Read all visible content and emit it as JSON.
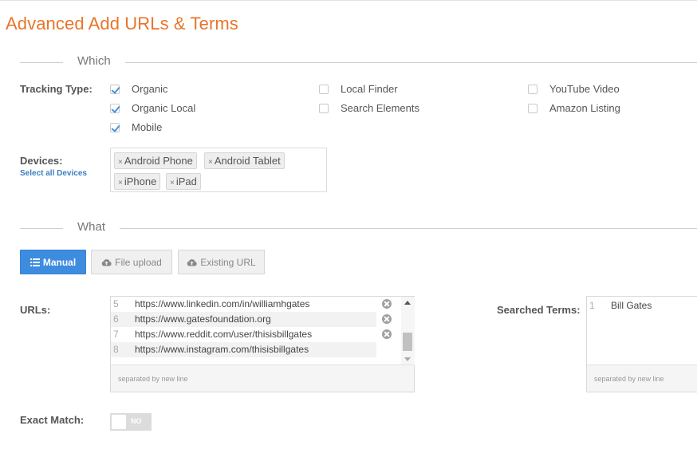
{
  "page": {
    "title": "Advanced Add URLs & Terms"
  },
  "which": {
    "heading": "Which",
    "tracking_label": "Tracking Type:",
    "tracking_types": [
      {
        "label": "Organic",
        "checked": true
      },
      {
        "label": "Organic Local",
        "checked": true
      },
      {
        "label": "Mobile",
        "checked": true
      },
      {
        "label": "Local Finder",
        "checked": false
      },
      {
        "label": "Search Elements",
        "checked": false
      },
      {
        "label": "YouTube Video",
        "checked": false
      },
      {
        "label": "Amazon Listing",
        "checked": false
      }
    ],
    "devices_label": "Devices:",
    "select_all_devices": "Select all Devices",
    "devices": [
      "Android Phone",
      "Android Tablet",
      "iPhone",
      "iPad"
    ],
    "remove_glyph": "×"
  },
  "what": {
    "heading": "What",
    "tabs": [
      {
        "label": "Manual",
        "icon": "list-icon",
        "active": true
      },
      {
        "label": "File upload",
        "icon": "cloud-upload-icon",
        "active": false
      },
      {
        "label": "Existing URL",
        "icon": "cloud-upload-icon",
        "active": false
      }
    ],
    "urls_label": "URLs:",
    "urls": [
      {
        "line": "5",
        "url": "https://www.linkedin.com/in/williamhgates"
      },
      {
        "line": "6",
        "url": "https://www.gatesfoundation.org"
      },
      {
        "line": "7",
        "url": "https://www.reddit.com/user/thisisbillgates"
      },
      {
        "line": "8",
        "url": "https://www.instagram.com/thisisbillgates"
      }
    ],
    "urls_hint": "separated by new line",
    "terms_label": "Searched Terms:",
    "terms": [
      {
        "line": "1",
        "term": "Bill Gates"
      }
    ],
    "terms_hint": "separated by new line",
    "exact_match_label": "Exact Match:",
    "exact_match_state": "NO"
  },
  "colors": {
    "title": "#e8752a",
    "primary": "#3d8ce0",
    "link": "#3a7fc1",
    "check": "#4a90d9"
  }
}
